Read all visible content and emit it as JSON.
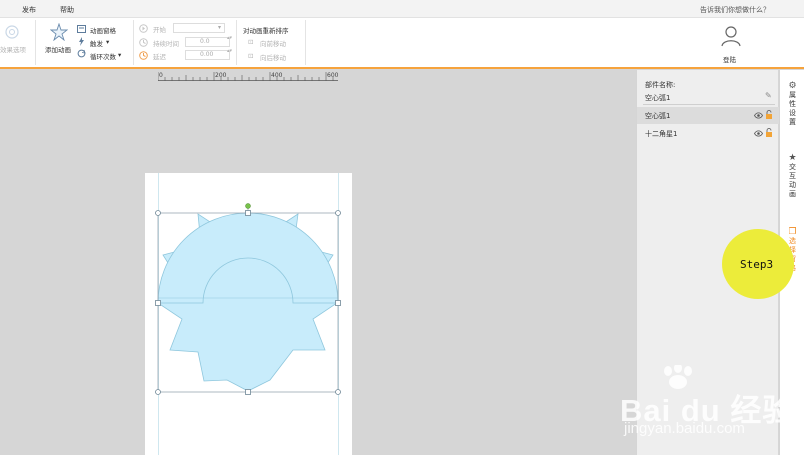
{
  "menu": {
    "items": [
      "发布",
      "帮助"
    ],
    "tell_me": "告诉我们你想做什么？"
  },
  "ribbon": {
    "effect_options": "效果选项",
    "add_animation": "添加动画",
    "animation_pane": "动画窗格",
    "trigger": "触发",
    "loop_count": "循环次数",
    "start": "开始",
    "duration": "持续时间",
    "delay": "延迟",
    "duration_value": "0.0",
    "delay_value": "0.00",
    "reorder_title": "对动画重新排序",
    "move_earlier": "向前移动",
    "move_later": "向后移动",
    "login": "登陆"
  },
  "ruler": {
    "labels": [
      "0",
      "200",
      "400",
      "600"
    ]
  },
  "panel": {
    "name_label": "部件名称:",
    "current_name": "空心弧1",
    "layers": [
      {
        "name": "空心弧1",
        "selected": true
      },
      {
        "name": "十二角星1",
        "selected": false
      }
    ]
  },
  "right_tabs": {
    "tab1": [
      "属",
      "性",
      "设",
      "置"
    ],
    "tab2": [
      "交",
      "互",
      "动",
      "画"
    ],
    "tab3": [
      "选",
      "择",
      "窗",
      "格"
    ]
  },
  "callout": {
    "label": "Step3",
    "color": "#ecec3a"
  },
  "watermark": {
    "brand": "Bai du 经验",
    "url": "jingyan.baidu.com"
  },
  "colors": {
    "accent": "#f6a33c",
    "shape_fill": "#c8ecfb",
    "shape_stroke": "#8fc7dd"
  }
}
